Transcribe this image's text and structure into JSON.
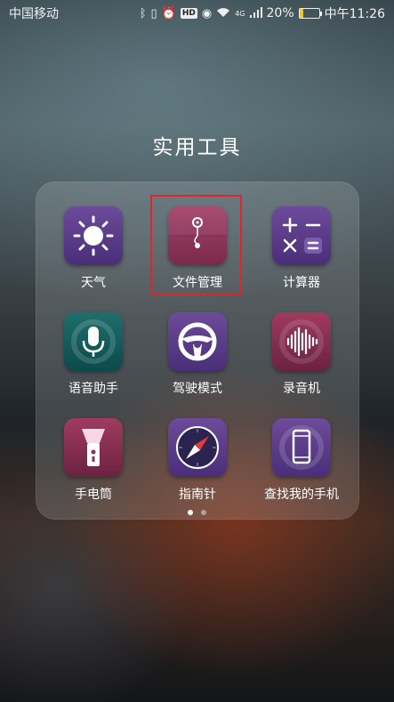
{
  "status_bar": {
    "carrier": "中国移动",
    "network_badge": "4G",
    "battery_percent": "20%",
    "battery_level": 0.2,
    "time": "中午11:26",
    "hd_badge": "HD"
  },
  "folder": {
    "title": "实用工具",
    "apps": [
      {
        "label": "天气",
        "icon": "sun-icon"
      },
      {
        "label": "文件管理",
        "icon": "folder-clip-icon"
      },
      {
        "label": "计算器",
        "icon": "calculator-icon"
      },
      {
        "label": "语音助手",
        "icon": "microphone-icon"
      },
      {
        "label": "驾驶模式",
        "icon": "steering-wheel-icon"
      },
      {
        "label": "录音机",
        "icon": "sound-wave-icon"
      },
      {
        "label": "手电筒",
        "icon": "flashlight-icon"
      },
      {
        "label": "指南针",
        "icon": "compass-icon"
      },
      {
        "label": "查找我的手机",
        "icon": "phone-icon"
      }
    ],
    "page_count": 2,
    "current_page": 1
  },
  "colors": {
    "highlight": "#e0242a",
    "battery_fill": "#f3c623"
  }
}
